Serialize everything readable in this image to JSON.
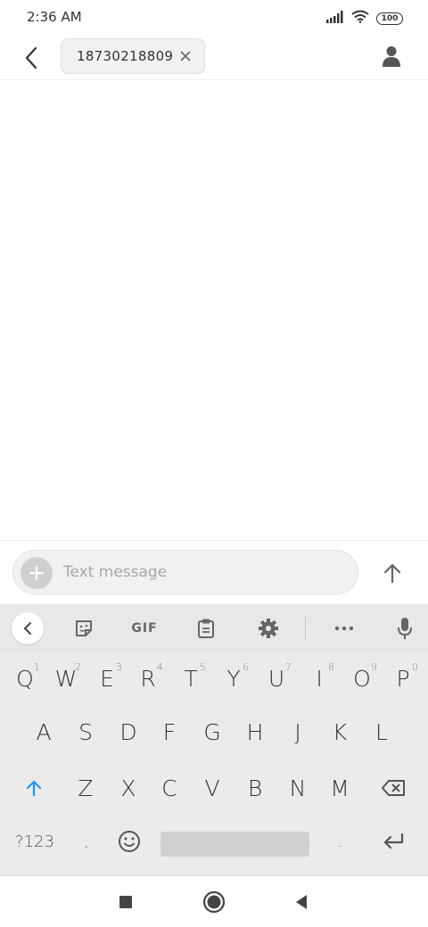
{
  "status_bar": {
    "time": "2:36 AM",
    "battery": "100"
  },
  "header": {
    "recipient_chip": "18730218809"
  },
  "compose": {
    "placeholder": "Text message"
  },
  "keyboard": {
    "toolbar": {
      "gif_label": "GIF"
    },
    "rows": [
      [
        {
          "k": "Q",
          "h": "1"
        },
        {
          "k": "W",
          "h": "2"
        },
        {
          "k": "E",
          "h": "3"
        },
        {
          "k": "R",
          "h": "4"
        },
        {
          "k": "T",
          "h": "5"
        },
        {
          "k": "Y",
          "h": "6"
        },
        {
          "k": "U",
          "h": "7"
        },
        {
          "k": "I",
          "h": "8"
        },
        {
          "k": "O",
          "h": "9"
        },
        {
          "k": "P",
          "h": "0"
        }
      ],
      [
        {
          "k": "A"
        },
        {
          "k": "S"
        },
        {
          "k": "D"
        },
        {
          "k": "F"
        },
        {
          "k": "G"
        },
        {
          "k": "H"
        },
        {
          "k": "J"
        },
        {
          "k": "K"
        },
        {
          "k": "L"
        }
      ],
      [
        {
          "k": "Z"
        },
        {
          "k": "X"
        },
        {
          "k": "C"
        },
        {
          "k": "V"
        },
        {
          "k": "B"
        },
        {
          "k": "N"
        },
        {
          "k": "M"
        }
      ]
    ],
    "symbols_label": "?123",
    "comma": ",",
    "period": "."
  },
  "icons": {
    "back": "back-arrow-icon",
    "chip_close": "close-icon",
    "contact": "person-icon",
    "add": "plus-icon",
    "send": "arrow-up-icon",
    "sticker": "sticker-icon",
    "clipboard": "clipboard-icon",
    "settings": "gear-icon",
    "more": "more-horizontal-icon",
    "mic": "microphone-icon",
    "shift": "shift-icon",
    "backspace": "backspace-icon",
    "emoji": "emoji-icon",
    "enter": "enter-icon",
    "nav_recents": "square-icon",
    "nav_home": "home-circle-icon",
    "nav_back": "triangle-back-icon"
  },
  "colors": {
    "shift_accent": "#2196f3",
    "keyboard_bg": "#ebebeb"
  }
}
